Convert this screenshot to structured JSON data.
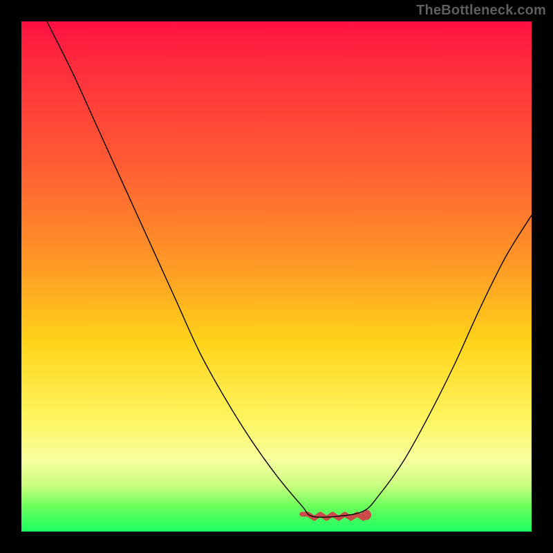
{
  "attribution": "TheBottleneck.com",
  "chart_data": {
    "type": "line",
    "title": "",
    "xlabel": "",
    "ylabel": "",
    "xlim": [
      0,
      100
    ],
    "ylim": [
      0,
      100
    ],
    "series": [
      {
        "name": "bottleneck-curve",
        "x": [
          5,
          10,
          15,
          20,
          25,
          30,
          35,
          40,
          45,
          50,
          55,
          57,
          62,
          67,
          70,
          75,
          80,
          85,
          90,
          95,
          100
        ],
        "y": [
          100,
          90,
          79,
          68,
          57,
          46,
          35,
          26,
          18,
          11,
          5,
          3,
          3,
          4,
          7,
          14,
          23,
          33,
          44,
          54,
          62
        ]
      }
    ],
    "highlight_range": {
      "name": "optimal-region",
      "x_start": 55,
      "x_end": 67,
      "y": 3
    },
    "gradient_stops": [
      {
        "pos": 0,
        "color": "#ff1042"
      },
      {
        "pos": 28,
        "color": "#ff5c34"
      },
      {
        "pos": 63,
        "color": "#ffd41a"
      },
      {
        "pos": 86,
        "color": "#f8ffa0"
      },
      {
        "pos": 100,
        "color": "#1aff60"
      }
    ]
  }
}
